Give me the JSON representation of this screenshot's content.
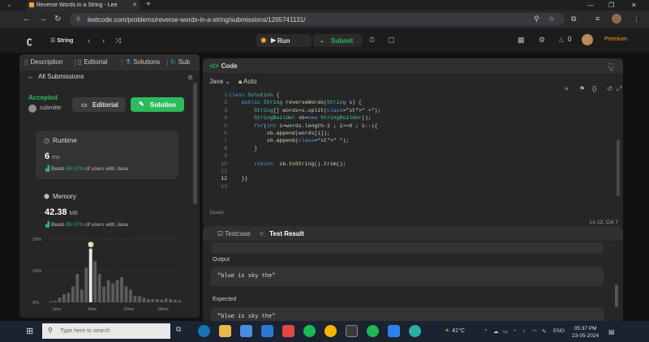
{
  "browser": {
    "tab_title": "Reverse Words in a String - Lee",
    "tab_close": "✕",
    "new_tab": "+",
    "url": "leetcode.com/problems/reverse-words-in-a-string/submissions/1265741131/"
  },
  "nav": {
    "problem_list_label": "String",
    "run_label": "Run",
    "submit_label": "Submit",
    "fire_count": "0",
    "premium_label": "Premium"
  },
  "left_panel": {
    "tabs": [
      "Description",
      "Editorial",
      "Solutions",
      "Sub"
    ],
    "all_submissions": "All Submissions",
    "status": "Accepted",
    "submitted_by": "submitte",
    "editorial_btn": "Editorial",
    "solution_btn": "Solution",
    "runtime": {
      "title": "Runtime",
      "value": "6",
      "unit": "ms",
      "beats_prefix": "Beats",
      "beats_pct": "84.07%",
      "beats_suffix": "of users with Java"
    },
    "memory": {
      "title": "Memory",
      "value": "42.38",
      "unit": "MB",
      "beats_prefix": "Beats",
      "beats_pct": "95.07%",
      "beats_suffix": "of users with Java"
    }
  },
  "chart_data": {
    "type": "bar",
    "title": "",
    "xlabel": "",
    "ylabel": "",
    "y_ticks": [
      "20%",
      "10%",
      "0%"
    ],
    "x_ticks": [
      "1ms",
      "8ms",
      "15ms",
      "18ms"
    ],
    "ylim": [
      0,
      20
    ],
    "highlight_index": 9,
    "values": [
      0.3,
      0.5,
      1.5,
      2.5,
      3,
      5,
      9,
      4,
      11,
      17,
      13,
      9,
      5,
      7,
      6,
      7,
      8,
      5,
      4,
      2,
      2,
      1.5,
      1,
      1,
      1,
      0.8,
      1.2,
      1,
      0.8,
      0.6
    ]
  },
  "code_panel": {
    "title": "Code",
    "language": "Java",
    "mode": "Auto",
    "saved": "Saved",
    "cursor": "Ln 12, Col 7",
    "lines": [
      "class Solution {",
      "    public String reverseWords(String s) {",
      "        String[] words=s.split(\" +\");",
      "        StringBuilder sb=new StringBuilder();",
      "        for(int i=words.length-1 ; i>=0 ; i--){",
      "            sb.append(words[i]);",
      "            sb.append(\" \");",
      "        }",
      "",
      "        return  sb.toString().trim();",
      "",
      "    }}",
      ""
    ]
  },
  "test_panel": {
    "testcase_tab": "Testcase",
    "result_tab": "Test Result",
    "output_label": "Output",
    "output_value": "\"blue is sky the\"",
    "expected_label": "Expected",
    "expected_value": "\"blue is sky the\""
  },
  "taskbar": {
    "search_placeholder": "Type here to search",
    "temperature": "41°C",
    "language": "ENG",
    "time": "05:37 PM",
    "date": "23-05-2024"
  },
  "colors": {
    "accent_green": "#2cbb5d",
    "premium_orange": "#ffa116",
    "panel_bg": "#262626"
  }
}
